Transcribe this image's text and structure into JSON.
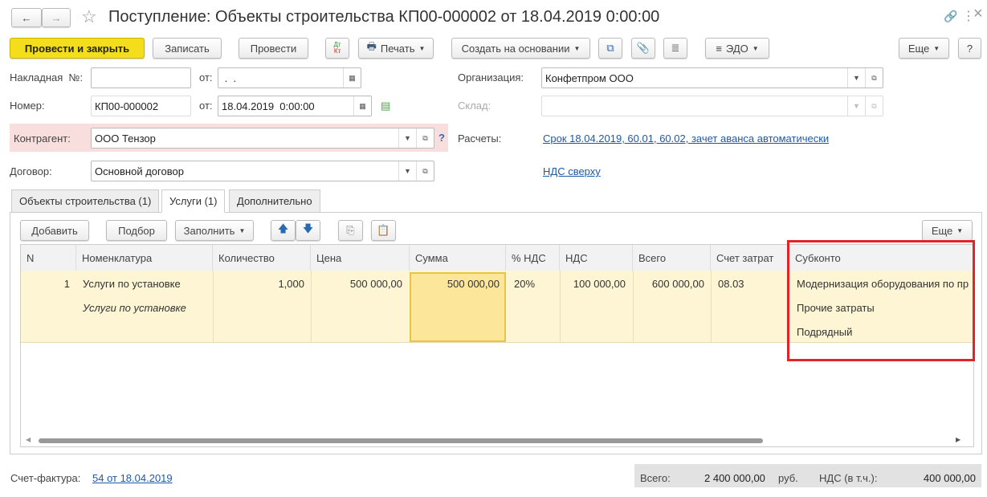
{
  "window": {
    "title": "Поступление: Объекты строительства КП00-000002 от 18.04.2019 0:00:00",
    "back": "←",
    "forward": "→",
    "star": "☆",
    "link_icon": "🔗",
    "more": "⋮",
    "close": "×"
  },
  "toolbar": {
    "post_close": "Провести и закрыть",
    "save": "Записать",
    "post": "Провести",
    "dtkt_top": "Дт",
    "dtkt_bottom": "Кт",
    "print": "Печать",
    "create_based": "Создать на основании",
    "edo": "ЭДО",
    "more": "Еще",
    "help": "?"
  },
  "form": {
    "invoice_label": "Накладная  №:",
    "invoice_value": "",
    "from_label": "от:",
    "invoice_date": " .  .",
    "number_label": "Номер:",
    "number_value": "КП00-000002",
    "date_value": "18.04.2019  0:00:00",
    "counterparty_label": "Контрагент:",
    "counterparty_value": "ООО Тензор",
    "question": "?",
    "contract_label": "Договор:",
    "contract_value": "Основной договор",
    "org_label": "Организация:",
    "org_value": "Конфетпром ООО",
    "warehouse_label": "Склад:",
    "warehouse_value": "",
    "settlements_label": "Расчеты:",
    "settlements_link": "Срок 18.04.2019, 60.01, 60.02, зачет аванса автоматически",
    "vat_link": "НДС сверху"
  },
  "tabs": [
    {
      "label": "Объекты строительства (1)"
    },
    {
      "label": "Услуги (1)"
    },
    {
      "label": "Дополнительно"
    }
  ],
  "table_toolbar": {
    "add": "Добавить",
    "pick": "Подбор",
    "fill": "Заполнить",
    "more": "Еще"
  },
  "table": {
    "columns": [
      "N",
      "Номенклатура",
      "Количество",
      "Цена",
      "Сумма",
      "% НДС",
      "НДС",
      "Всего",
      "Счет затрат",
      "Субконто"
    ],
    "rows": [
      {
        "n": "1",
        "item": "Услуги по установке",
        "item2": "Услуги по установке",
        "qty": "1,000",
        "price": "500 000,00",
        "sum": "500 000,00",
        "vat_rate": "20%",
        "vat": "100 000,00",
        "total": "600 000,00",
        "account": "08.03",
        "sub1": "Модернизация оборудования по пр",
        "sub2": "Прочие затраты",
        "sub3": "Подрядный"
      }
    ]
  },
  "footer": {
    "invoice_label": "Счет-фактура:",
    "invoice_link": "54 от 18.04.2019",
    "total_label": "Всего:",
    "total_value": "2 400 000,00",
    "currency": "руб.",
    "vat_label": "НДС (в т.ч.):",
    "vat_value": "400 000,00"
  },
  "colors": {
    "primary": "#f4dd1b",
    "row": "#fdf5d3",
    "highlight": "#e0242a",
    "link": "#1c5aa8"
  }
}
